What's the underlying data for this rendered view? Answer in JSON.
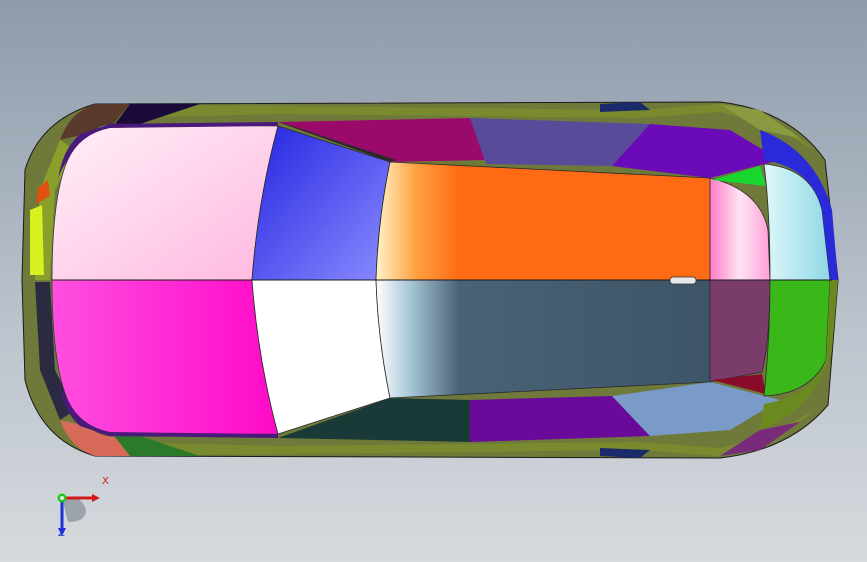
{
  "viewport": {
    "background_top": "#8e9bab",
    "background_bottom": "#d6dade"
  },
  "model": {
    "name": "car-body-top-view",
    "colors": {
      "hood_front": "#ffc8e8",
      "hood_rear": "#ff1ad0",
      "windshield_top": "#3a3ee6",
      "windshield_bottom": "#ffffff",
      "roof_top": "#ff6a14",
      "roof_bottom": "#3d5567",
      "rear_glass_top": "#ff9fd8",
      "rear_glass_bottom": "#7a3d6a",
      "tail_top": "#b8ecf2",
      "tail_bottom": "#3ab81a"
    }
  },
  "triad": {
    "x_label": "X",
    "z_label": "Z",
    "x_color": "#d21b1b",
    "y_color": "#1ec81e",
    "z_color": "#1d2fd6"
  }
}
